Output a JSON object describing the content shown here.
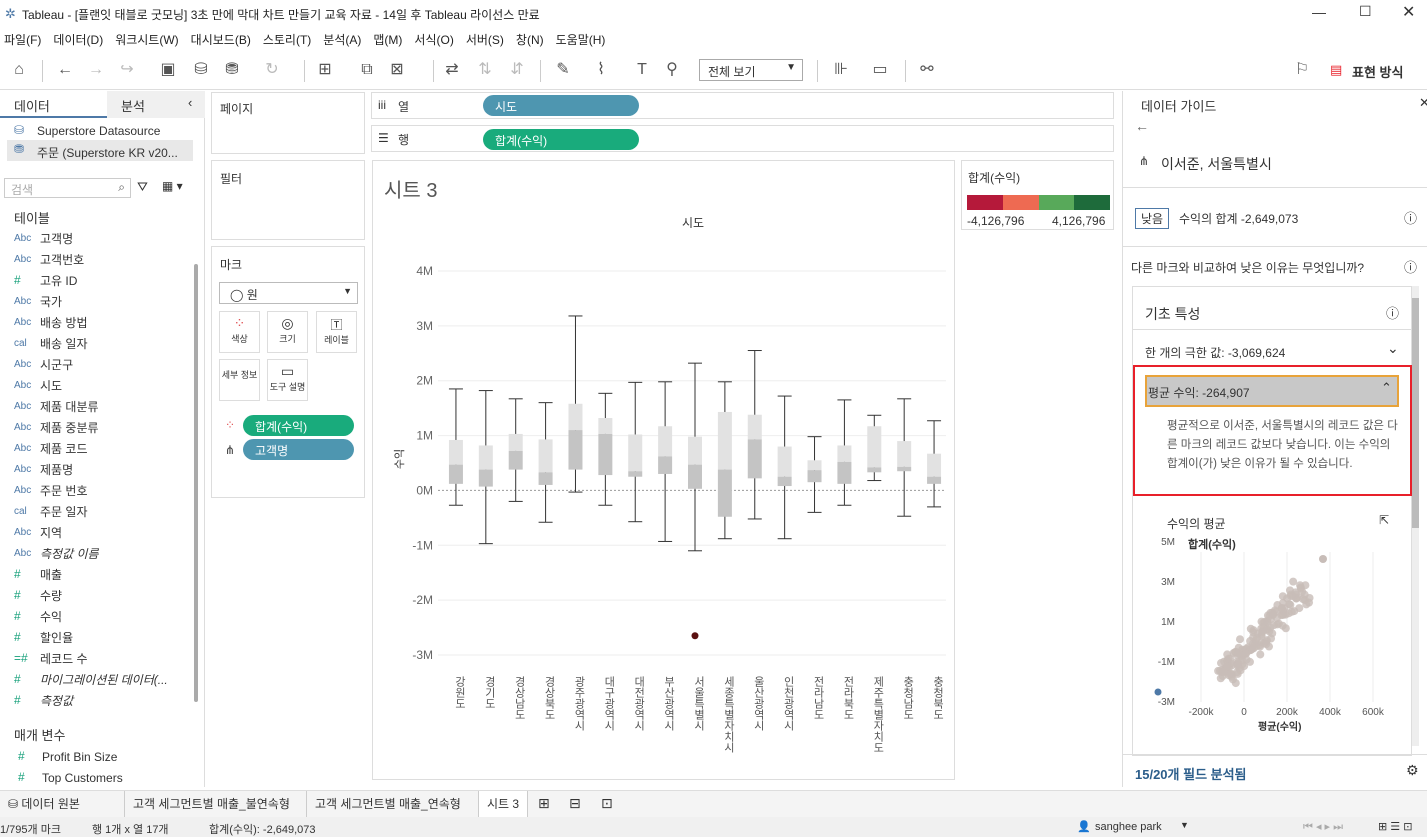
{
  "window": {
    "title": "Tableau - [플랜잇 태블로 굿모닝] 3초 만에 막대 차트 만들기 교육 자료 - 14일 후 Tableau 라이선스 만료"
  },
  "menu": [
    "파일(F)",
    "데이터(D)",
    "워크시트(W)",
    "대시보드(B)",
    "스토리(T)",
    "분석(A)",
    "맵(M)",
    "서식(O)",
    "서버(S)",
    "창(N)",
    "도움말(H)"
  ],
  "toolbar": {
    "fit": "전체 보기",
    "show_me": "표현 방식"
  },
  "left": {
    "tab_data": "데이터",
    "tab_analysis": "분석",
    "datasource1": "Superstore Datasource",
    "datasource2": "주문 (Superstore KR v20...",
    "search_placeholder": "검색",
    "tables_header": "테이블",
    "fields": [
      {
        "type": "Abc",
        "name": "고객명"
      },
      {
        "type": "Abc",
        "name": "고객번호"
      },
      {
        "type": "#",
        "name": "고유 ID"
      },
      {
        "type": "Abc",
        "name": "국가"
      },
      {
        "type": "Abc",
        "name": "배송 방법"
      },
      {
        "type": "cal",
        "name": "배송 일자"
      },
      {
        "type": "Abc",
        "name": "시군구"
      },
      {
        "type": "Abc",
        "name": "시도"
      },
      {
        "type": "Abc",
        "name": "제품 대분류"
      },
      {
        "type": "Abc",
        "name": "제품 중분류"
      },
      {
        "type": "Abc",
        "name": "제품 코드"
      },
      {
        "type": "Abc",
        "name": "제품명"
      },
      {
        "type": "Abc",
        "name": "주문 번호"
      },
      {
        "type": "cal",
        "name": "주문 일자"
      },
      {
        "type": "Abc",
        "name": "지역"
      },
      {
        "type": "Abc",
        "name": "측정값 이름"
      },
      {
        "type": "#",
        "name": "매출"
      },
      {
        "type": "#",
        "name": "수량"
      },
      {
        "type": "#",
        "name": "수익"
      },
      {
        "type": "#",
        "name": "할인율"
      },
      {
        "type": "=#",
        "name": "레코드 수"
      },
      {
        "type": "#",
        "name": "마이그레이션된 데이터(..."
      },
      {
        "type": "#",
        "name": "측정값"
      }
    ],
    "params_header": "매개 변수",
    "params": [
      "Profit Bin Size",
      "Top Customers"
    ]
  },
  "shelves": {
    "pages": "페이지",
    "filters": "필터",
    "marks": "마크",
    "mark_type": "원",
    "mark_buttons": [
      "색상",
      "크기",
      "레이블",
      "세부 정보",
      "도구 설명"
    ],
    "mark_pills": [
      "합계(수익)",
      "고객명"
    ],
    "columns_label": "열",
    "columns_pill": "시도",
    "rows_label": "행",
    "rows_pill": "합계(수익)"
  },
  "legend": {
    "title": "합계(수익)",
    "min": "-4,126,796",
    "max": "4,126,796"
  },
  "chart_data": {
    "type": "box",
    "title": "시트 3",
    "xlabel": "시도",
    "ylabel": "수익",
    "yticks": [
      "4M",
      "3M",
      "2M",
      "1M",
      "0M",
      "-1M",
      "-2M",
      "-3M"
    ],
    "ylim": [
      -3.2,
      4.2
    ],
    "categories": [
      "강원도",
      "경기도",
      "경상남도",
      "경상북도",
      "광주광역시",
      "대구광역시",
      "대전광역시",
      "부산광역시",
      "서울특별시",
      "세종특별자치시",
      "울산광역시",
      "인천광역시",
      "전라남도",
      "전라북도",
      "제주특별자치도",
      "충청남도",
      "충청북도"
    ],
    "boxes": [
      {
        "lo": -0.27,
        "q1": 0.12,
        "med": 0.47,
        "q3": 0.92,
        "hi": 1.85
      },
      {
        "lo": -0.97,
        "q1": 0.07,
        "med": 0.38,
        "q3": 0.82,
        "hi": 1.82
      },
      {
        "lo": -0.2,
        "q1": 0.38,
        "med": 0.72,
        "q3": 1.03,
        "hi": 1.67
      },
      {
        "lo": -0.58,
        "q1": 0.1,
        "med": 0.33,
        "q3": 0.93,
        "hi": 1.6
      },
      {
        "lo": -0.03,
        "q1": 0.38,
        "med": 1.1,
        "q3": 1.58,
        "hi": 3.18
      },
      {
        "lo": -0.27,
        "q1": 0.28,
        "med": 1.03,
        "q3": 1.32,
        "hi": 1.77
      },
      {
        "lo": -0.57,
        "q1": 0.25,
        "med": 0.35,
        "q3": 1.02,
        "hi": 1.97
      },
      {
        "lo": -0.93,
        "q1": 0.3,
        "med": 0.62,
        "q3": 1.17,
        "hi": 1.98
      },
      {
        "lo": -1.1,
        "q1": 0.03,
        "med": 0.47,
        "q3": 0.98,
        "hi": 2.32
      },
      {
        "lo": -0.88,
        "q1": -0.48,
        "med": 0.38,
        "q3": 1.43,
        "hi": 1.98
      },
      {
        "lo": -0.52,
        "q1": 0.22,
        "med": 0.93,
        "q3": 1.38,
        "hi": 2.55
      },
      {
        "lo": -0.88,
        "q1": 0.08,
        "med": 0.25,
        "q3": 0.8,
        "hi": 1.72
      },
      {
        "lo": -0.4,
        "q1": 0.15,
        "med": 0.37,
        "q3": 0.55,
        "hi": 0.98
      },
      {
        "lo": -0.27,
        "q1": 0.12,
        "med": 0.52,
        "q3": 0.82,
        "hi": 1.65
      },
      {
        "lo": 0.18,
        "q1": 0.33,
        "med": 0.42,
        "q3": 1.17,
        "hi": 1.37
      },
      {
        "lo": -0.47,
        "q1": 0.35,
        "med": 0.43,
        "q3": 0.9,
        "hi": 1.67
      },
      {
        "lo": -0.3,
        "q1": 0.12,
        "med": 0.25,
        "q3": 0.67,
        "hi": 1.27
      }
    ],
    "highlight": {
      "category": "서울특별시",
      "value": -2.649073
    },
    "grid": true
  },
  "guide": {
    "title": "데이터 가이드",
    "entity": "이서준, 서울특별시",
    "badge": "낮음",
    "sum_label": "수익의 합계 -2,649,073",
    "question": "다른 마크와 비교하여 낮은 이유는 무엇입니까?",
    "section": "기초 특성",
    "extreme": "한 개의 극한 값: -3,069,624",
    "avg_header": "평균 수익: -264,907",
    "avg_text": "평균적으로 이서준, 서울특별시의 레코드 값은 다른 마크의 레코드 값보다 낮습니다. 이는 수익의 합계이(가) 낮은 이유가 될 수 있습니다.",
    "mini_title": "수익의 평균",
    "mini_y": "합계(수익)",
    "mini_x": "평균(수익)",
    "mini_yticks": [
      "5M",
      "3M",
      "1M",
      "-1M",
      "-3M"
    ],
    "mini_xticks": [
      "-200k",
      "0",
      "200k",
      "400k",
      "600k"
    ],
    "footer": "15/20개 필드 분석됨"
  },
  "sheets": {
    "datasource_tab": "데이터 원본",
    "tabs": [
      "고객 세그먼트별 매출_불연속형",
      "고객 세그먼트별 매출_연속형",
      "시트 3"
    ]
  },
  "status": {
    "marks": "1/795개 마크",
    "rows_cols": "행 1개 x 열 17개",
    "sum": "합계(수익): -2,649,073",
    "user": "sanghee park"
  },
  "colors": {
    "blue_pill": "#4e96b0",
    "green_pill": "#19ab7c",
    "highlight_border": "#e8202a",
    "orange_border": "#e8a33a"
  }
}
